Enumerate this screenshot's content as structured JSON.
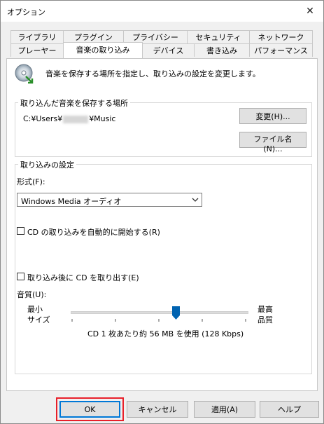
{
  "window": {
    "title": "オプション",
    "close_glyph": "✕"
  },
  "tabs": {
    "row1": [
      "ライブラリ",
      "プラグイン",
      "プライバシー",
      "セキュリティ",
      "ネットワーク"
    ],
    "row2": [
      "プレーヤー",
      "音楽の取り込み",
      "デバイス",
      "書き込み",
      "パフォーマンス"
    ],
    "active": "音楽の取り込み"
  },
  "header": {
    "icon": "cd-rip-icon",
    "description": "音楽を保存する場所を指定し、取り込みの設定を変更します。"
  },
  "save_location": {
    "legend": "取り込んだ音楽を保存する場所",
    "path_prefix": "C:¥Users¥",
    "path_suffix": "¥Music",
    "change_button": "変更(H)...",
    "filename_button": "ファイル名(N)..."
  },
  "rip_settings": {
    "legend": "取り込みの設定",
    "format_label": "形式(F):",
    "format_value": "Windows Media オーディオ",
    "auto_rip_label": "CD の取り込みを自動的に開始する(R)",
    "eject_label": "取り込み後に CD を取り出す(E)",
    "quality_label": "音質(U):",
    "min_label_1": "最小",
    "min_label_2": "サイズ",
    "max_label_1": "最高",
    "max_label_2": "品質",
    "quality_info": "CD 1 枚あたり約 56 MB を使用 (128 Kbps)",
    "quality_level": 0.6
  },
  "footer": {
    "ok": "OK",
    "cancel": "キャンセル",
    "apply": "適用(A)",
    "help": "ヘルプ"
  },
  "colors": {
    "highlight": "#e8202a",
    "ok_border": "#0078d7",
    "slider_thumb": "#0063b1"
  }
}
